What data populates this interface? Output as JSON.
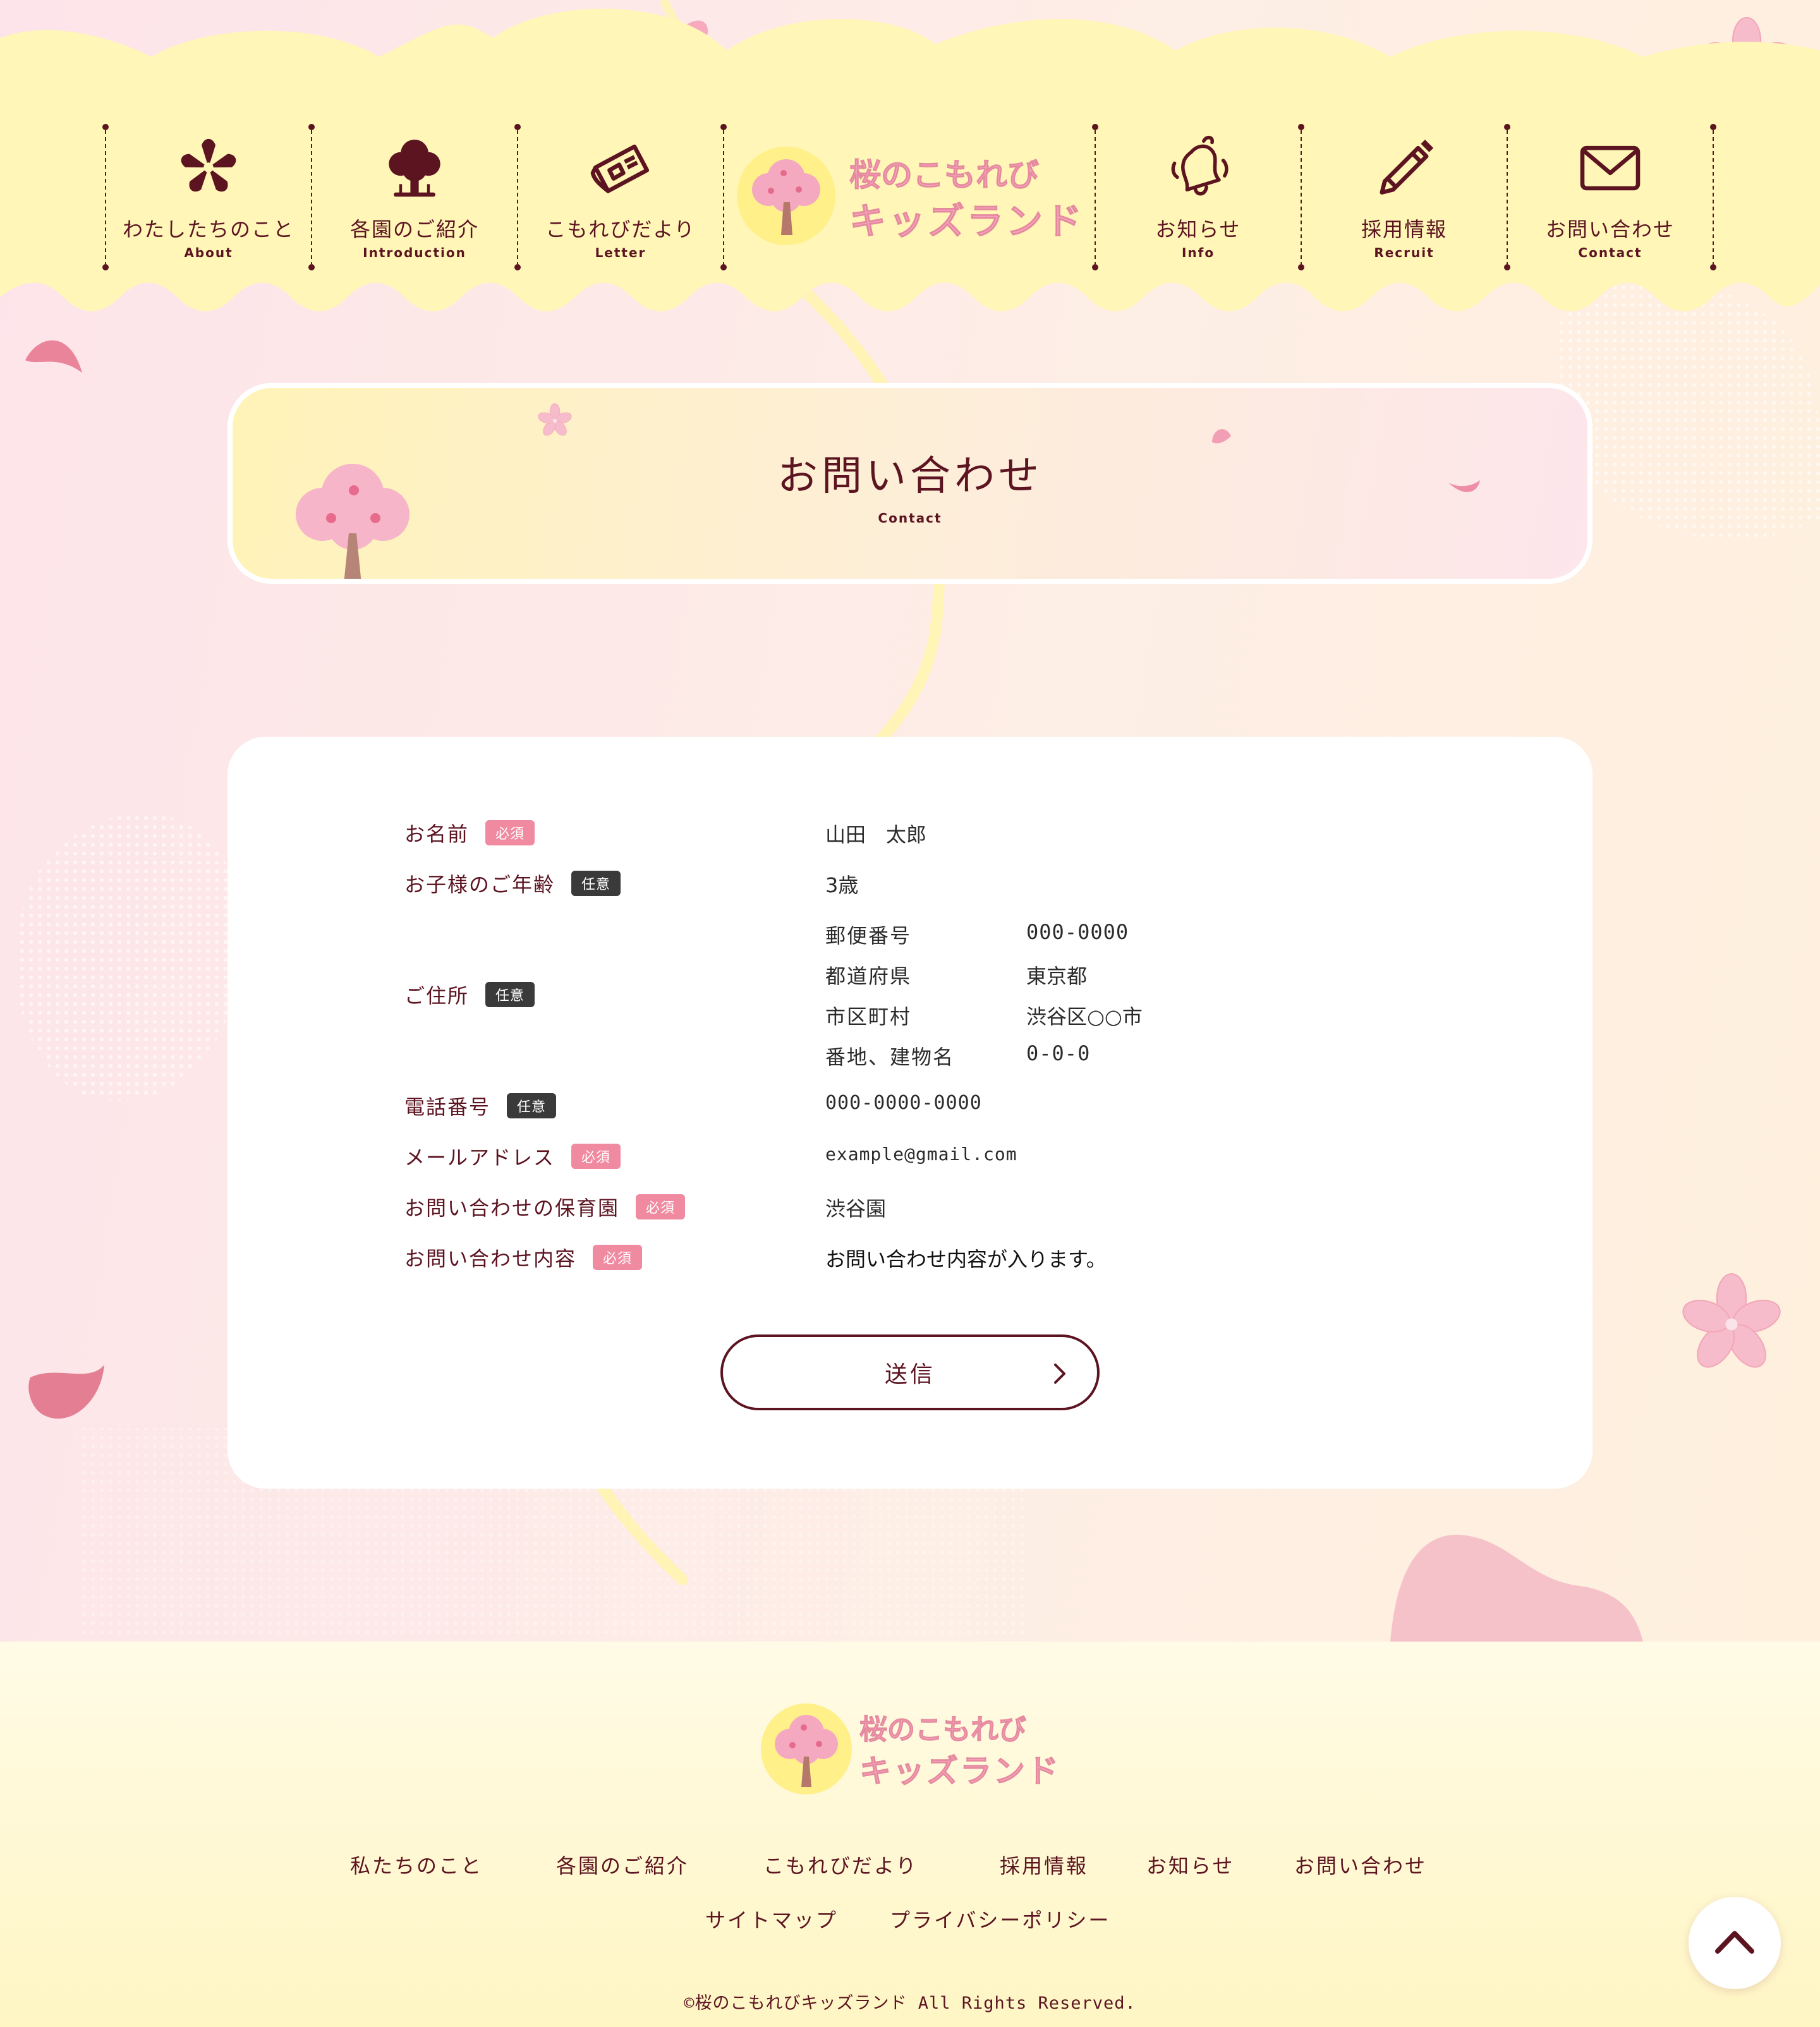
{
  "site": {
    "logo_line1": "桜のこもれび",
    "logo_line2": "キッズランド"
  },
  "nav": {
    "items": [
      {
        "jp": "わたしたちのこと",
        "en": "About",
        "icon": "sakura-flower-icon"
      },
      {
        "jp": "各園のご紹介",
        "en": "Introduction",
        "icon": "tree-icon"
      },
      {
        "jp": "こもれびだより",
        "en": "Letter",
        "icon": "newspaper-icon"
      },
      {
        "jp": "お知らせ",
        "en": "Info",
        "icon": "bell-icon"
      },
      {
        "jp": "採用情報",
        "en": "Recruit",
        "icon": "pencil-icon"
      },
      {
        "jp": "お問い合わせ",
        "en": "Contact",
        "icon": "envelope-icon"
      }
    ]
  },
  "page": {
    "title": "お問い合わせ",
    "subtitle": "Contact"
  },
  "form": {
    "badges": {
      "required": "必須",
      "optional": "任意"
    },
    "name": {
      "label": "お名前",
      "value": "山田　太郎"
    },
    "child_age": {
      "label": "お子様のご年齢",
      "value": "3歳"
    },
    "address": {
      "label": "ご住所",
      "postal_label": "郵便番号",
      "postal_value": "000-0000",
      "prefecture_label": "都道府県",
      "prefecture_value": "東京都",
      "city_label": "市区町村",
      "city_value": "渋谷区○○市",
      "street_label": "番地、建物名",
      "street_value": "0-0-0"
    },
    "phone": {
      "label": "電話番号",
      "value": "000-0000-0000"
    },
    "email": {
      "label": "メールアドレス",
      "value": "example@gmail.com"
    },
    "nursery": {
      "label": "お問い合わせの保育園",
      "value": "渋谷園"
    },
    "inquiry": {
      "label": "お問い合わせ内容",
      "value": "お問い合わせ内容が入ります。"
    },
    "submit_label": "送信"
  },
  "footer": {
    "links": [
      "私たちのこと",
      "各園のご紹介",
      "こもれびだより",
      "採用情報",
      "お知らせ",
      "お問い合わせ"
    ],
    "sub_links": [
      "サイトマップ",
      "プライバシーポリシー"
    ],
    "copyright": "©桜のこもれびキッズランド All Rights Reserved."
  },
  "colors": {
    "primary": "#5c1421",
    "required_badge": "#f08aa0",
    "optional_badge": "#3a3a3a",
    "header_yellow": "#fff6b8",
    "sakura_pink": "#f6b7c7"
  }
}
